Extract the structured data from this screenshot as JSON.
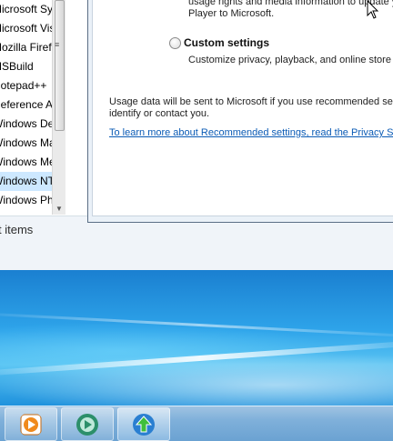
{
  "explorer": {
    "files": [
      "Microsoft Sy",
      "Microsoft Vis",
      "Mozilla Firefo",
      "MSBuild",
      "Notepad++",
      "Reference As",
      "Windows Def",
      "Windows Ma",
      "Windows Me",
      "Windows NT",
      "Windows Pho"
    ],
    "status_text": "t items"
  },
  "dialog": {
    "top_text_line1": "usage rights and media information to update y",
    "top_text_line2": "Player to Microsoft.",
    "custom_label": "Custom settings",
    "custom_desc": "Customize privacy, playback, and online store s",
    "usage_line1": "Usage data will be sent to Microsoft if you use recommended setti",
    "usage_line2": "identify or contact you.",
    "privacy_link": "To learn more about Recommended settings, read the Privacy Sta"
  },
  "taskbar": {
    "buttons": [
      {
        "name": "media-player",
        "icon": "play-icon",
        "color": "#f08a1c"
      },
      {
        "name": "media-center",
        "icon": "media-center-icon",
        "color": "#2c8f6a"
      },
      {
        "name": "update",
        "icon": "update-arrow-icon",
        "color": "#2a7fd1"
      }
    ]
  }
}
